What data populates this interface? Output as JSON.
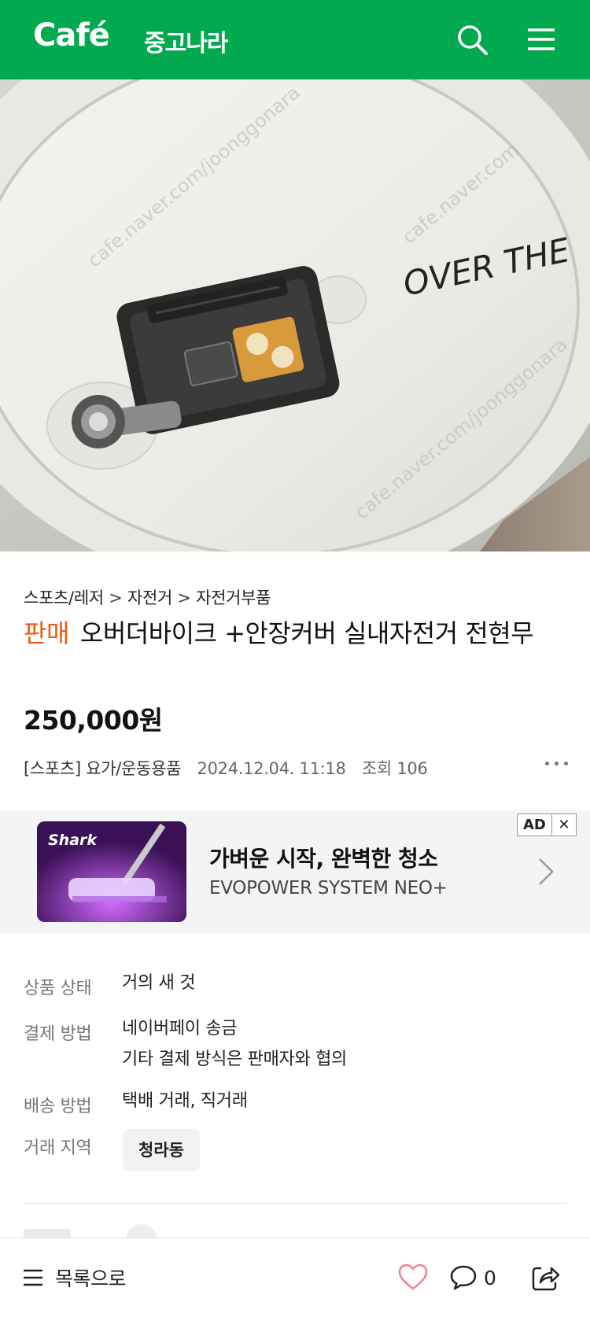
{
  "header": {
    "logo_text": "Café",
    "cafe_name": "중고나라",
    "bg_color": "#03a94f",
    "icons": [
      "search-icon",
      "menu-icon"
    ]
  },
  "photo": {
    "description_icon": "product-photo",
    "brand_text": "OVER THE"
  },
  "article": {
    "breadcrumb": [
      "스포츠/레저",
      "자전거",
      "자전거부품"
    ],
    "breadcrumb_sep": ">",
    "status": "판매",
    "status_color": "#e95d12",
    "title": "오버더바이크 +안장커버 실내자전거 전현무",
    "price": "250,000원",
    "board": "[스포츠] 요가/운동용품",
    "date": "2024.12.04. 11:18",
    "views": "조회 106"
  },
  "ad": {
    "thumb_brand": "Shark",
    "headline": "가벼운 시작, 완벽한 청소",
    "subline": "EVOPOWER SYSTEM NEO+",
    "badge": "AD",
    "close": "✕"
  },
  "info": [
    {
      "label": "상품 상태",
      "lines": [
        "거의 새 것"
      ]
    },
    {
      "label": "결제 방법",
      "lines": [
        "네이버페이 송금",
        "기타 결제 방식은 판매자와 협의"
      ]
    },
    {
      "label": "배송 방법",
      "lines": [
        "택배 거래, 직거래"
      ]
    },
    {
      "label": "거래 지역",
      "chip": "청라동"
    }
  ],
  "bottom_bar": {
    "list_label": "목록으로",
    "comment_count": "0",
    "heart_color": "#f0848a",
    "icons": [
      "hamburger-icon",
      "heart-icon",
      "comment-icon",
      "share-icon"
    ]
  }
}
